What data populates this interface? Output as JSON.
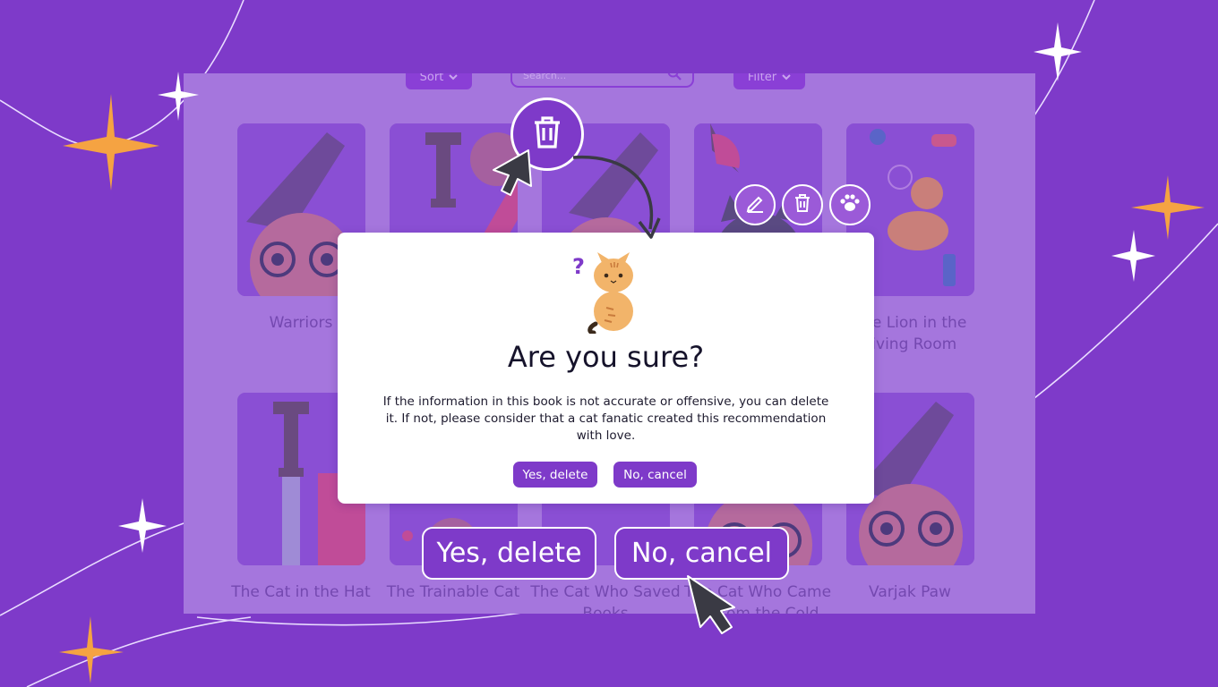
{
  "toolbar": {
    "sort_label": "Sort",
    "search_placeholder": "Search...",
    "filter_label": "Filter"
  },
  "books": [
    {
      "title": "Warriors"
    },
    {
      "title": ""
    },
    {
      "title": ""
    },
    {
      "title": ""
    },
    {
      "title": "The Lion in the Living Room"
    },
    {
      "title": "The Cat in the Hat"
    },
    {
      "title": "The Trainable Cat"
    },
    {
      "title": "The Cat Who Saved Books"
    },
    {
      "title": "The Cat Who Came in from the Cold"
    },
    {
      "title": "Varjak Paw"
    }
  ],
  "card_actions": {
    "icons": [
      "pencil-icon",
      "trash-icon",
      "paw-icon"
    ]
  },
  "dialog": {
    "title": "Are you sure?",
    "message": "If the information in this book is not accurate or offensive, you can delete it. If not, please consider that a cat fanatic created this recommendation with love.",
    "confirm_label": "Yes, delete",
    "cancel_label": "No, cancel"
  },
  "callouts": {
    "confirm_label": "Yes, delete",
    "cancel_label": "No, cancel"
  },
  "colors": {
    "brand_purple": "#7e3ac9",
    "overlay_purple": "#a576dd",
    "accent_orange": "#f5a342",
    "cursor_dark": "#3a3a44"
  }
}
